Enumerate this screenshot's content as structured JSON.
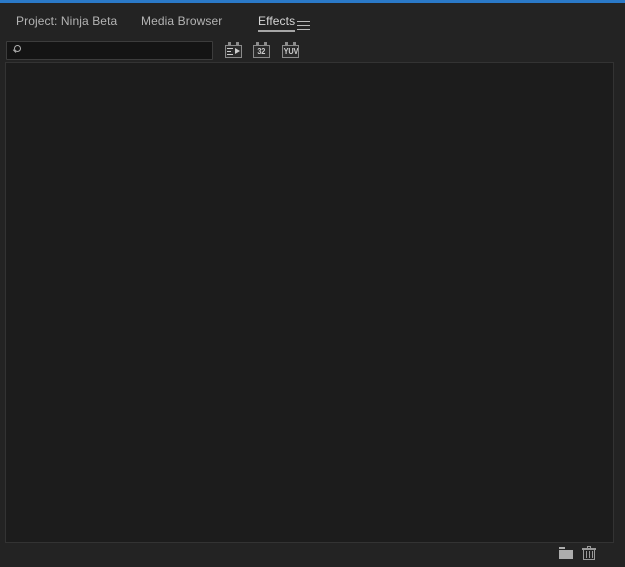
{
  "panel": {
    "background_color": "#232323",
    "focus_accent_color": "#2a79c8",
    "list_background_color": "#1c1c1c"
  },
  "tabs": [
    {
      "id": "project",
      "label": "Project: Ninja Beta",
      "active": false
    },
    {
      "id": "media_browser",
      "label": "Media Browser",
      "active": false
    },
    {
      "id": "effects",
      "label": "Effects",
      "active": true
    }
  ],
  "panel_menu": {
    "icon": "hamburger-menu-icon",
    "tooltip": "Panel Menu"
  },
  "search": {
    "value": "",
    "placeholder": "",
    "icon": "search-icon"
  },
  "filters": [
    {
      "id": "accelerated",
      "icon": "accelerated-effects-icon",
      "label": "",
      "active": false
    },
    {
      "id": "bit32",
      "icon": "32-bit-color-icon",
      "label": "32",
      "active": false
    },
    {
      "id": "yuv",
      "icon": "yuv-color-icon",
      "label": "YUV",
      "active": false
    }
  ],
  "effects_list": {
    "items": [],
    "empty": true
  },
  "footer": {
    "buttons": [
      {
        "id": "new_custom_bin",
        "icon": "new-folder-icon",
        "label": "New Custom Bin"
      },
      {
        "id": "delete_custom_item",
        "icon": "trash-icon",
        "label": "Delete Custom Item"
      }
    ]
  }
}
